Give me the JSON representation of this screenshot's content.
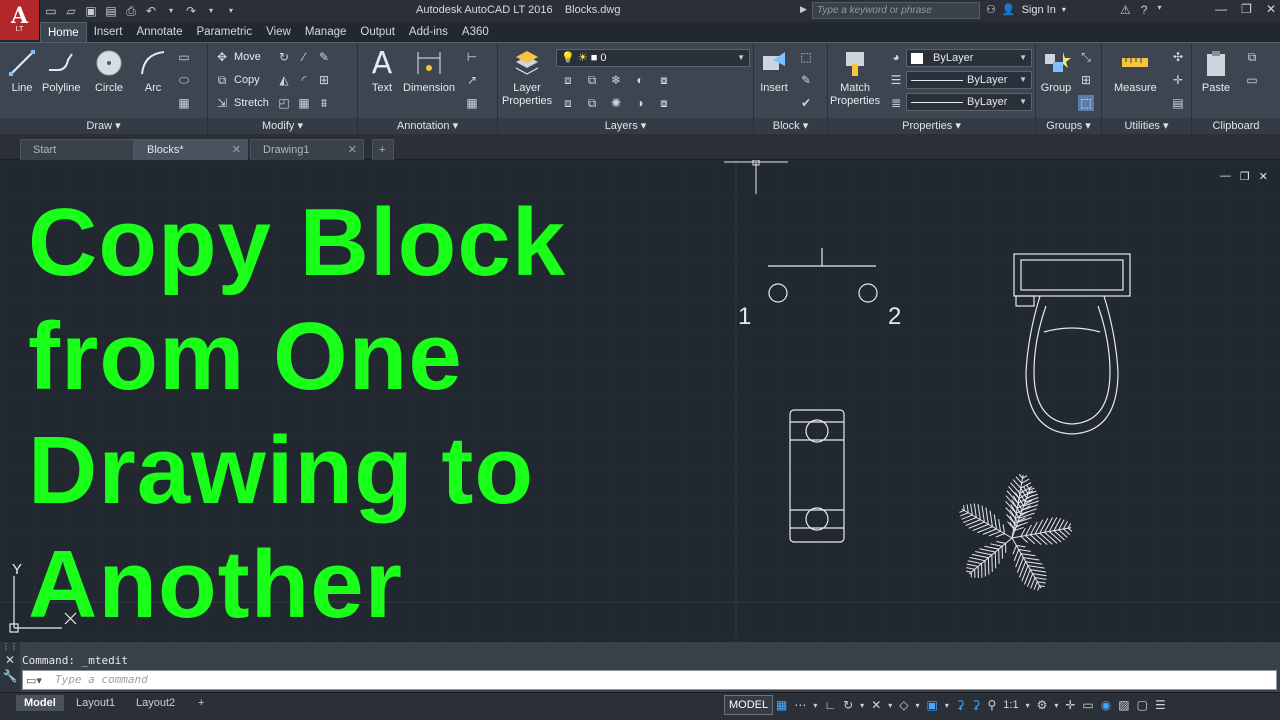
{
  "app": {
    "logo_text": "A",
    "logo_sub": "LT",
    "title": "Autodesk AutoCAD LT 2016",
    "document": "Blocks.dwg",
    "search_placeholder": "Type a keyword or phrase",
    "sign_in": "Sign In"
  },
  "ribbon_tabs": [
    "Home",
    "Insert",
    "Annotate",
    "Parametric",
    "View",
    "Manage",
    "Output",
    "Add-ins",
    "A360"
  ],
  "panels": {
    "draw": {
      "title": "Draw",
      "tools": [
        "Line",
        "Polyline",
        "Circle",
        "Arc"
      ]
    },
    "modify": {
      "title": "Modify",
      "tools": [
        "Move",
        "Copy",
        "Stretch"
      ]
    },
    "annotation": {
      "title": "Annotation",
      "tools": [
        "Text",
        "Dimension"
      ]
    },
    "layers": {
      "title": "Layers",
      "tool": "Layer\nProperties",
      "layer_value": "0"
    },
    "block": {
      "title": "Block",
      "tool": "Insert"
    },
    "properties": {
      "title": "Properties",
      "tool": "Match\nProperties",
      "color": "ByLayer",
      "linetype": "ByLayer",
      "lineweight": "ByLayer"
    },
    "groups": {
      "title": "Groups",
      "tool": "Group"
    },
    "utilities": {
      "title": "Utilities",
      "tool": "Measure"
    },
    "clipboard": {
      "title": "Clipboard",
      "tool": "Paste"
    }
  },
  "file_tabs": [
    {
      "label": "Start"
    },
    {
      "label": "Blocks*"
    },
    {
      "label": "Drawing1"
    }
  ],
  "canvas": {
    "headline": [
      "Copy Block",
      "from One",
      "Drawing to",
      "Another"
    ],
    "switch_label_1": "1",
    "switch_label_2": "2",
    "ucs_y": "Y",
    "ucs_x": "X"
  },
  "command": {
    "history": "Command: _mtedit",
    "placeholder": "Type a command"
  },
  "layout_tabs": [
    "Model",
    "Layout1",
    "Layout2"
  ],
  "status": {
    "model": "MODEL",
    "scale": "1:1"
  },
  "colors": {
    "headline": "#19ff19",
    "canvas_bg": "#212830",
    "ribbon_bg": "#3d4550"
  }
}
